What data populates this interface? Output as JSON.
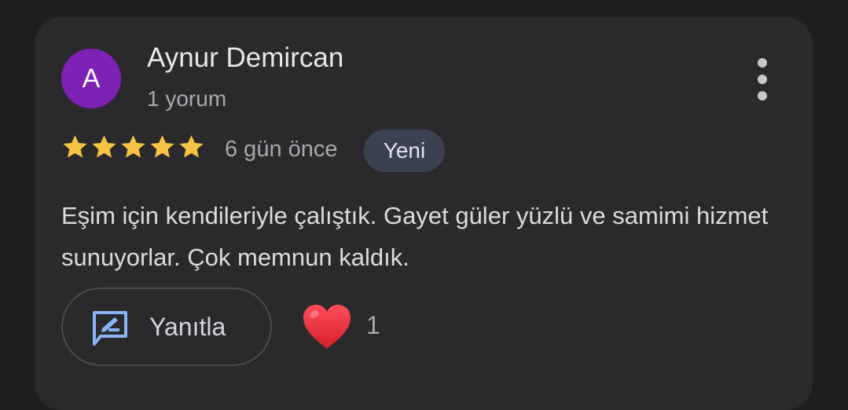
{
  "review": {
    "author": {
      "initial": "A",
      "name": "Aynur Demircan",
      "review_count": "1 yorum",
      "avatar_color": "#7e22b5"
    },
    "rating": 5,
    "max_rating": 5,
    "star_color": "#f6c343",
    "date": "6 gün önce",
    "badge": "Yeni",
    "text": "Eşim için kendileriyle çalıştık. Gayet güler yüzlü ve samimi hizmet sunuyorlar. Çok memnun kaldık.",
    "actions": {
      "reply_label": "Yanıtla",
      "reply_icon": "rate-review-icon",
      "reaction_icon": "heart-icon",
      "reaction_count": "1"
    },
    "more_options_icon": "more-vert-icon"
  }
}
